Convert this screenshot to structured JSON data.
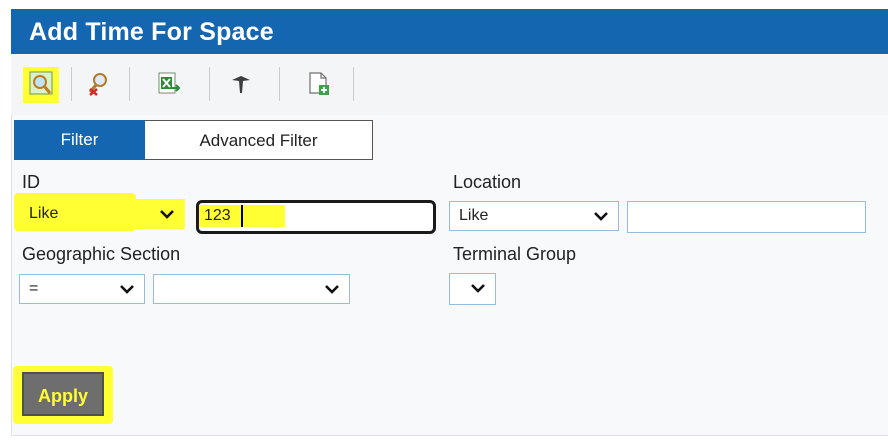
{
  "window": {
    "title": "Add Time For Space"
  },
  "toolbar": {
    "buttons": [
      {
        "icon": "search-icon"
      },
      {
        "icon": "clear-search-icon"
      },
      {
        "icon": "export-excel-icon"
      },
      {
        "icon": "pin-icon"
      },
      {
        "icon": "new-document-icon"
      }
    ]
  },
  "tabs": {
    "filter": "Filter",
    "advanced": "Advanced Filter"
  },
  "fields": {
    "id": {
      "label": "ID",
      "operator": "Like",
      "value": "123"
    },
    "location": {
      "label": "Location",
      "operator": "Like",
      "value": ""
    },
    "geographic_section": {
      "label": "Geographic Section",
      "operator": "=",
      "value": ""
    },
    "terminal_group": {
      "label": "Terminal Group",
      "value": ""
    }
  },
  "actions": {
    "apply": "Apply"
  },
  "colors": {
    "brand": "#1466b0",
    "highlight": "#ffff33"
  }
}
